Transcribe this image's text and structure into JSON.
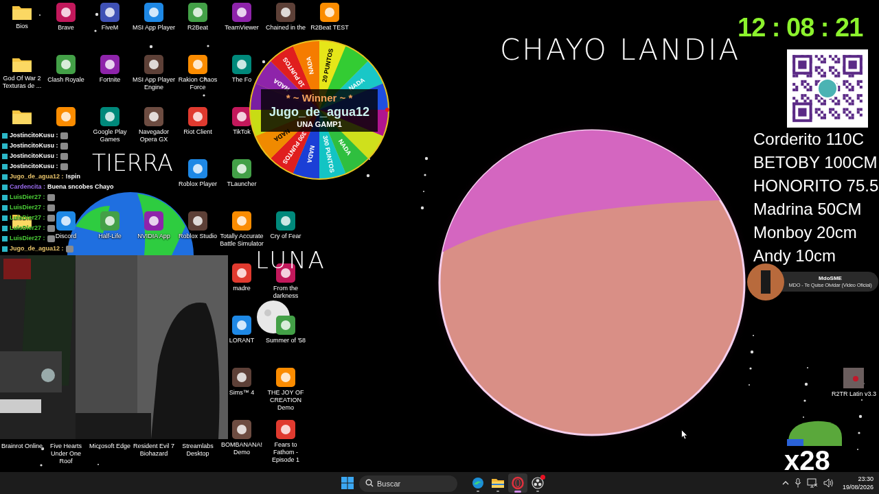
{
  "desktop_rows": [
    [
      {
        "kind": "folder",
        "label": "Bios"
      },
      {
        "kind": "app",
        "label": "Brave"
      },
      {
        "kind": "app",
        "label": "FiveM"
      },
      {
        "kind": "app",
        "label": "MSI App Player"
      },
      {
        "kind": "app",
        "label": "R2Beat"
      },
      {
        "kind": "app",
        "label": "TeamViewer"
      },
      {
        "kind": "app",
        "label": "Chained in the"
      },
      {
        "kind": "app",
        "label": "R2Beat TEST"
      }
    ],
    [
      {
        "kind": "folder",
        "label": "God Of War 2 Texturas de ..."
      },
      {
        "kind": "app",
        "label": "Clash Royale"
      },
      {
        "kind": "app",
        "label": "Fortnite"
      },
      {
        "kind": "app",
        "label": "MSI App Player Engine"
      },
      {
        "kind": "app",
        "label": "Rakion Chaos Force"
      },
      {
        "kind": "app",
        "label": "The Fo"
      },
      null,
      null
    ],
    [
      {
        "kind": "folder"
      },
      {
        "kind": "app"
      },
      {
        "kind": "app",
        "label": "Google Play Games"
      },
      {
        "kind": "app",
        "label": "Navegador Opera GX"
      },
      {
        "kind": "app",
        "label": "Riot Client"
      },
      {
        "kind": "app",
        "label": "TikTok"
      },
      null,
      null
    ],
    [
      null,
      null,
      null,
      null,
      {
        "kind": "app",
        "label": "Roblox Player"
      },
      {
        "kind": "app",
        "label": "TLauncher"
      },
      null,
      null
    ],
    [
      {
        "kind": "folder"
      },
      {
        "kind": "app",
        "label": "Discord"
      },
      {
        "kind": "app",
        "label": "Half-Life"
      },
      {
        "kind": "app",
        "label": "NVIDIA App"
      },
      {
        "kind": "app",
        "label": "Roblox Studio"
      },
      {
        "kind": "app",
        "label": "Totally Accurate Battle Simulator"
      },
      {
        "kind": "app",
        "label": "Cry of Fear"
      },
      null
    ],
    [
      null,
      null,
      null,
      null,
      null,
      {
        "kind": "app",
        "label": "madre"
      },
      {
        "kind": "app",
        "label": "From the darkness"
      },
      null
    ],
    [
      null,
      null,
      null,
      null,
      null,
      {
        "kind": "app",
        "label": "LORANT"
      },
      {
        "kind": "app",
        "label": "Summer of '58"
      },
      null
    ],
    [
      null,
      null,
      null,
      null,
      null,
      {
        "kind": "app",
        "label": "Sims™ 4"
      },
      {
        "kind": "app",
        "label": "THE JOY OF CREATION Demo"
      },
      null
    ],
    [
      {
        "kind": "label_only",
        "label": "Brainrot Online"
      },
      {
        "kind": "label_only",
        "label": "Five Hearts Under One Roof"
      },
      {
        "kind": "label_only",
        "label": "Microsoft Edge"
      },
      {
        "kind": "label_only",
        "label": "Resident Evil 7 Biohazard"
      },
      {
        "kind": "label_only",
        "label": "Streamlabs Desktop"
      },
      {
        "kind": "app",
        "label": "BOMBANANA! Demo"
      },
      {
        "kind": "app",
        "label": "Fears to Fathom - Episode 1"
      },
      null
    ]
  ],
  "corner_icon": {
    "label": "R2TR Latin v3.3"
  },
  "handwritten_titles": {
    "top": "CHAYO LANDIA",
    "earth": "TIERRA",
    "moon": "LUNA"
  },
  "chat": [
    {
      "user": "JostincitoKusu :",
      "color": "#ffffff"
    },
    {
      "user": "JostincitoKusu :",
      "color": "#ffffff"
    },
    {
      "user": "JostincitoKusu :",
      "color": "#ffffff"
    },
    {
      "user": "JostincitoKusu :",
      "color": "#ffffff"
    },
    {
      "user": "Jugo_de_agua12 :",
      "color": "#e8c36a",
      "message": "!spin"
    },
    {
      "user": "Cardencita :",
      "color": "#9b6cf0",
      "message": "Buena sncobes Chayo"
    },
    {
      "user": "LuisDier27 :",
      "color": "#4cd137"
    },
    {
      "user": "LuisDier27 :",
      "color": "#4cd137"
    },
    {
      "user": "LuisDier27 :",
      "color": "#4cd137"
    },
    {
      "user": "LuisDier27 :",
      "color": "#4cd137"
    },
    {
      "user": "LuisDier27 :",
      "color": "#4cd137"
    },
    {
      "user": "Jugo_de_agua12 :",
      "color": "#e8c36a"
    }
  ],
  "wheel": {
    "segments": [
      {
        "color": "#7a1fa2"
      },
      {
        "label": "NADA",
        "color": "#8e24aa"
      },
      {
        "label": "10 PUNTOS",
        "color": "#e01e1e"
      },
      {
        "label": "NADA",
        "color": "#f57c00"
      },
      {
        "label": "20 PUNTOS",
        "color": "#e6e619"
      },
      {
        "color": "#33cc33"
      },
      {
        "label": "NADA",
        "color": "#19c7c7"
      },
      {
        "color": "#1f4fe0"
      },
      {
        "color": "#b0158f"
      },
      {
        "color": "#cfe01c"
      },
      {
        "label": "NADA",
        "color": "#2fbf3f"
      },
      {
        "label": "300 PUNTOS",
        "color": "#13c4c4"
      },
      {
        "label": "NADA",
        "color": "#1b3fd6"
      },
      {
        "label": "300 PUNTOS",
        "color": "#e01e1e"
      },
      {
        "label": "NADA",
        "color": "#f08a00"
      },
      {
        "color": "#c8dc14"
      }
    ],
    "winner_heading": "* ~ Winner ~ *",
    "winner": "Jugo_de_agua12",
    "prize": "UNA GAMP1"
  },
  "timer": "12 : 08 : 21",
  "leaderboard": [
    "Corderito 110C",
    "BETOBY 100CM",
    "HONORITO 75.5",
    "Madrina 50CM",
    "Monboy 20cm",
    "Andy 10cm"
  ],
  "now_playing": {
    "artist": "MdoSME",
    "track": "MDO - Te Quise Olvidar (Video Oficial)"
  },
  "counter": "x28",
  "taskbar": {
    "search_placeholder": "Buscar",
    "apps": [
      {
        "kind": "edge",
        "active": false,
        "notification": false
      },
      {
        "kind": "explorer",
        "active": false,
        "notification": false
      },
      {
        "kind": "opera",
        "active": true,
        "notification": false
      },
      {
        "kind": "obs",
        "active": false,
        "notification": true
      }
    ],
    "time": "23:30",
    "date": "19/08/2026"
  }
}
